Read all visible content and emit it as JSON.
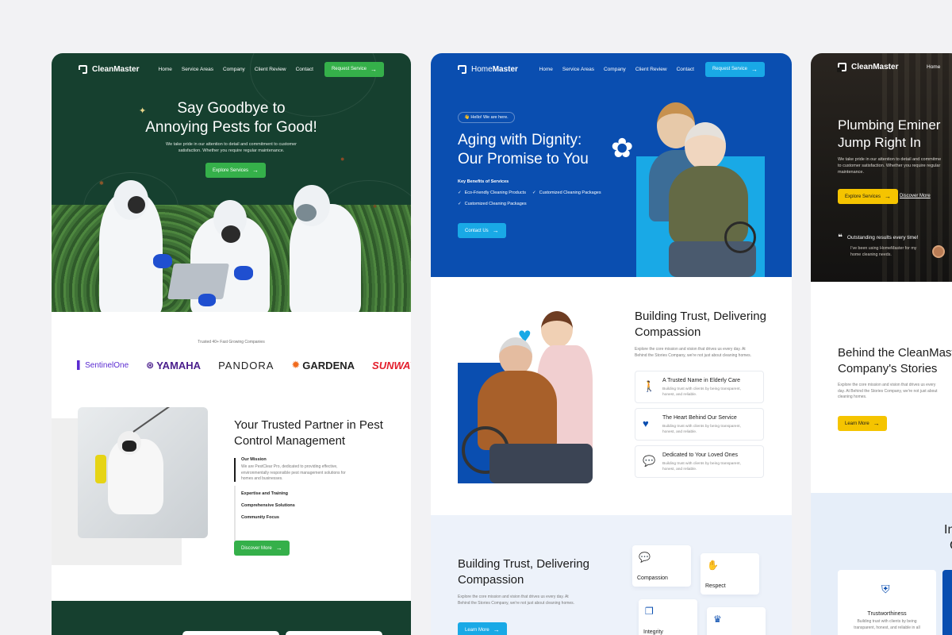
{
  "card1": {
    "brand": "CleanMaster",
    "nav": [
      "Home",
      "Service Areas",
      "Company",
      "Client Review",
      "Contact"
    ],
    "cta": "Request Service",
    "hero_line1": "Say Goodbye to",
    "hero_line2": "Annoying Pests for Good!",
    "hero_sub1": "We take pride in our attention to detail and commitment to customer",
    "hero_sub2": "satisfaction. Whether you require regular maintenance.",
    "hero_button": "Explore Services",
    "trusted": "Trusted 40+ Fast Growing Companies",
    "logos": [
      "SentinelOne",
      "YAMAHA",
      "PANDORA",
      "GARDENA",
      "SUNWAY"
    ],
    "partner_line1": "Your Trusted Partner in Pest",
    "partner_line2": "Control Management",
    "mission_label": "Our Mission",
    "mission_text1": "We are PestClear Pro, dedicated to providing effective,",
    "mission_text2": "environmentally responsible pest management solutions for",
    "mission_text3": "homes and businesses.",
    "items": [
      "Expertise and Training",
      "Comprehensive Solutions",
      "Community Focus"
    ],
    "discover": "Discover More",
    "accent": "#35b04a",
    "dark": "#16402f"
  },
  "card2": {
    "brand_a": "Home",
    "brand_b": "Master",
    "nav": [
      "Home",
      "Service Areas",
      "Company",
      "Client Review",
      "Contact"
    ],
    "cta": "Request Service",
    "pill": "👋 Hello! We are here.",
    "hero_line1": "Aging with Dignity:",
    "hero_line2": "Our Promise to You",
    "benefits_label": "Key Benefits of Services",
    "benefits": [
      "Eco-Friendly Cleaning Products",
      "Customized Cleaning Packages",
      "Customized Cleaning Packages"
    ],
    "contact": "Contact Us",
    "trust_line1": "Building Trust, Delivering",
    "trust_line2": "Compassion",
    "trust_sub1": "Explore the core mission and vision that drives us every day. At",
    "trust_sub2": "Behind the Stories Company, we're not just about cleaning homes.",
    "features": [
      {
        "title": "A Trusted Name in Elderly Care",
        "desc1": "Building trust with clients by being transparent,",
        "desc2": "honest, and reliable."
      },
      {
        "title": "The Heart Behind Our Service",
        "desc1": "Building trust with clients by being transparent,",
        "desc2": "honest, and reliable."
      },
      {
        "title": "Dedicated to Your Loved Ones",
        "desc1": "Building trust with clients by being transparent,",
        "desc2": "honest, and reliable."
      }
    ],
    "lower_line1": "Building Trust, Delivering",
    "lower_line2": "Compassion",
    "lower_sub1": "Explore the core mission and vision that drives us every day. At",
    "lower_sub2": "Behind the Stories Company, we're not just about cleaning homes.",
    "learn": "Learn More",
    "tiles": [
      "Compassion",
      "Respect",
      "Integrity"
    ],
    "blue": "#0a4eb0",
    "cyan": "#19a9e6"
  },
  "card3": {
    "brand": "CleanMaster",
    "nav_home": "Home",
    "hero_line1": "Plumbing Eminer",
    "hero_line2": "Jump Right In",
    "hero_sub1": "We take pride in our attention to detail and commitme",
    "hero_sub2": "to customer satisfaction. Whether you require regular",
    "hero_sub3": "maintenance.",
    "explore": "Explore Services",
    "discover": "Discover More",
    "quote_title": "Outstanding results every time!",
    "quote_text1": "I've been using HomeMaster for my",
    "quote_text2": "home cleaning needs.",
    "behind_line1": "Behind the CleanMast",
    "behind_line2": "Company's Stories",
    "behind_sub1": "Explore the core mission and vision that drives us every",
    "behind_sub2": "day. At Behind the Stories Company, we're not just about",
    "behind_sub3": "cleaning homes.",
    "learn": "Learn More",
    "partial_a": "In",
    "partial_b": "C",
    "trust_title": "Trustworthiness",
    "trust_text1": "Building trust with clients by being",
    "trust_text2": "transparent, honest, and reliable in all",
    "yellow": "#f5c400"
  }
}
